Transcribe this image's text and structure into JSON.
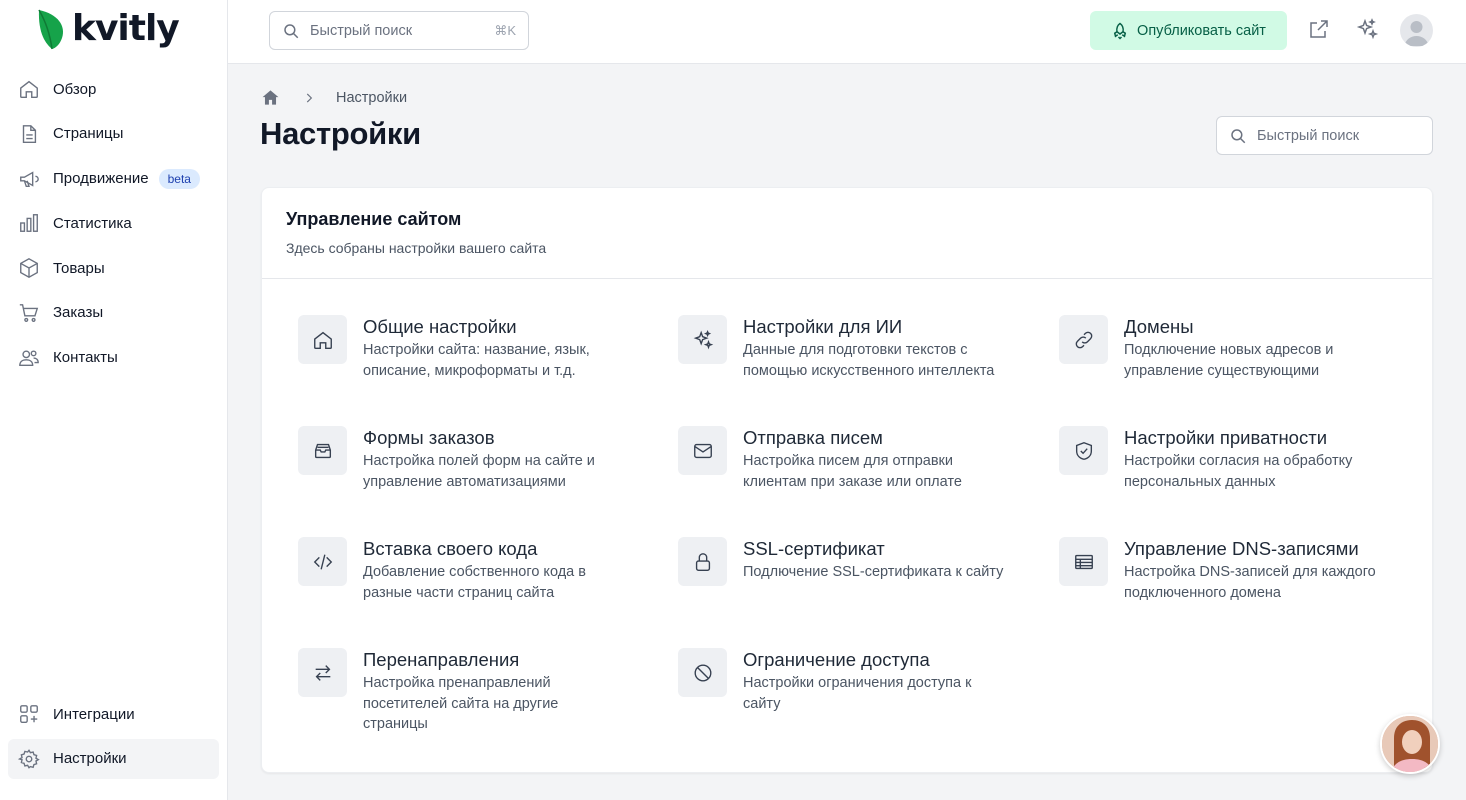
{
  "brand": {
    "name": "kvitly",
    "leaf_color": "#16a34a"
  },
  "sidebar": {
    "items": [
      {
        "label": "Обзор",
        "icon": "home-icon"
      },
      {
        "label": "Страницы",
        "icon": "document-icon"
      },
      {
        "label": "Продвижение",
        "icon": "megaphone-icon",
        "badge": "beta"
      },
      {
        "label": "Статистика",
        "icon": "chart-bars-icon"
      },
      {
        "label": "Товары",
        "icon": "cube-icon"
      },
      {
        "label": "Заказы",
        "icon": "cart-icon"
      },
      {
        "label": "Контакты",
        "icon": "users-icon"
      }
    ],
    "bottom_items": [
      {
        "label": "Интеграции",
        "icon": "squares-plus-icon"
      },
      {
        "label": "Настройки",
        "icon": "gear-icon",
        "active": true
      }
    ]
  },
  "topbar": {
    "search_placeholder": "Быстрый поиск",
    "search_shortcut": "⌘K",
    "publish_label": "Опубликовать сайт",
    "publish_bg": "#d1fae5",
    "publish_color": "#065f46"
  },
  "breadcrumb": {
    "current": "Настройки"
  },
  "page": {
    "title": "Настройки",
    "search_placeholder": "Быстрый поиск"
  },
  "card": {
    "title": "Управление сайтом",
    "subtitle": "Здесь собраны настройки вашего сайта",
    "tiles": [
      {
        "name": "Общие настройки",
        "desc": "Настройки сайта: название, язык, описание, микроформаты и т.д.",
        "icon": "home-icon"
      },
      {
        "name": "Настройки для ИИ",
        "desc": "Данные для подготовки текстов с помощью искусственного интеллекта",
        "icon": "sparkles-icon"
      },
      {
        "name": "Домены",
        "desc": "Подключение новых адресов и управление существующими",
        "icon": "link-icon"
      },
      {
        "name": "Формы заказов",
        "desc": "Настройка полей форм на сайте и управление автоматизациями",
        "icon": "inbox-stack-icon"
      },
      {
        "name": "Отправка писем",
        "desc": "Настройка писем для отправки клиентам при заказе или оплате",
        "icon": "envelope-icon"
      },
      {
        "name": "Настройки приватности",
        "desc": "Настройки согласия на обработку персональных данных",
        "icon": "shield-check-icon"
      },
      {
        "name": "Вставка своего кода",
        "desc": "Добавление собственного кода в разные части страниц сайта",
        "icon": "code-icon"
      },
      {
        "name": "SSL-сертификат",
        "desc": "Подлючение SSL-сертификата к сайту",
        "icon": "lock-icon"
      },
      {
        "name": "Управление DNS-записями",
        "desc": "Настройка DNS-записей для каждого подключенного домена",
        "icon": "table-icon"
      },
      {
        "name": "Перенаправления",
        "desc": "Настройка пренаправлений посетителей сайта на другие страницы",
        "icon": "arrows-swap-icon"
      },
      {
        "name": "Ограничение доступа",
        "desc": "Настройки ограничения доступа к сайту",
        "icon": "no-symbol-icon"
      }
    ]
  }
}
